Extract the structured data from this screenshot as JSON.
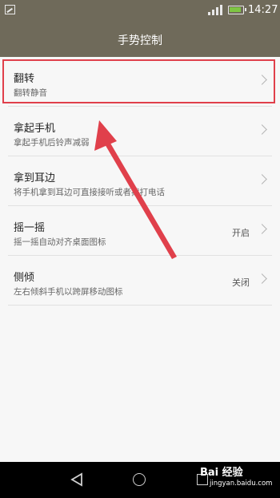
{
  "status_bar": {
    "time": "14:27",
    "battery_color": "#7ec543"
  },
  "header": {
    "title": "手势控制"
  },
  "settings": [
    {
      "title": "翻转",
      "subtitle": "翻转静音",
      "value": ""
    },
    {
      "title": "拿起手机",
      "subtitle": "拿起手机后铃声减弱",
      "value": ""
    },
    {
      "title": "拿到耳边",
      "subtitle": "将手机拿到耳边可直接接听或者拨打电话",
      "value": ""
    },
    {
      "title": "摇一摇",
      "subtitle": "摇一摇自动对齐桌面图标",
      "value": "开启"
    },
    {
      "title": "侧倾",
      "subtitle": "左右倾斜手机以跨屏移动图标",
      "value": "关闭"
    }
  ],
  "annotation": {
    "highlight_color": "#e0404b"
  },
  "watermark": {
    "brand": "Bai 经验",
    "url": "jingyan.baidu.com"
  },
  "navigation": {
    "icons": [
      "back-icon",
      "home-icon",
      "recent-apps-icon"
    ]
  }
}
